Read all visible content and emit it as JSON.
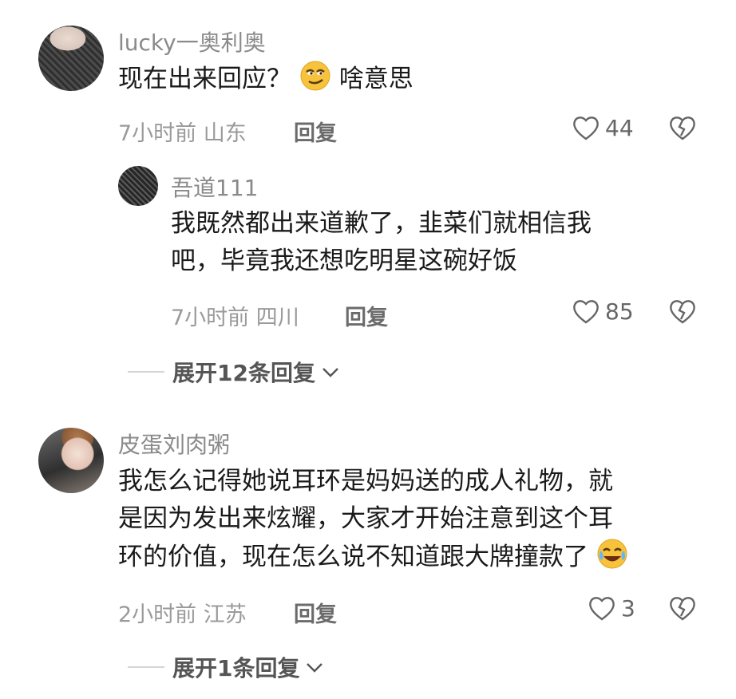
{
  "comments": [
    {
      "username": "lucky一奥利奥",
      "text_before": "现在出来回应？",
      "emoji": "smirk-emoji",
      "text_after": "啥意思",
      "time": "7小时前",
      "location": "山东",
      "reply_label": "回复",
      "likes": "44"
    },
    {
      "username": "吾道111",
      "line1": "我既然都出来道歉了，韭菜们就相信我",
      "line2": "吧，毕竟我还想吃明星这碗好饭",
      "time": "7小时前",
      "location": "四川",
      "reply_label": "回复",
      "likes": "85",
      "expand": "展开12条回复"
    },
    {
      "username": "皮蛋刘肉粥",
      "line1": "我怎么记得她说耳环是妈妈送的成人礼物，就",
      "line2": "是因为发出来炫耀，大家才开始注意到这个耳",
      "line3": "环的价值，现在怎么说不知道跟大牌撞款了",
      "emoji": "crying-laughing-emoji",
      "time": "2小时前",
      "location": "江苏",
      "reply_label": "回复",
      "likes": "3",
      "expand": "展开1条回复"
    }
  ],
  "colors": {
    "username": "#8a8a8a",
    "text": "#1a1a1a",
    "meta": "#9a9a9a"
  }
}
